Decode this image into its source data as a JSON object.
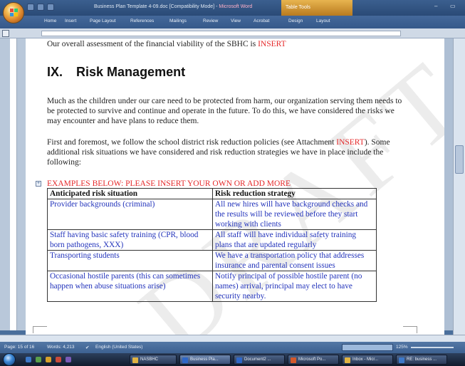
{
  "window": {
    "title_doc": "Business Plan Template 4-09.doc [Compatibility Mode] - ",
    "title_app": "Microsoft Word",
    "table_tools": "Table Tools",
    "min": "–",
    "max": "▭"
  },
  "ribbon": {
    "tabs": [
      "Home",
      "Insert",
      "Page Layout",
      "References",
      "Mailings",
      "Review",
      "View",
      "Acrobat",
      "Design",
      "Layout"
    ]
  },
  "document": {
    "top_line_text": "Our overall assessment of the financial viability of the SBHC is ",
    "top_line_insert": "INSERT",
    "heading_number": "IX.",
    "heading_text": "Risk Management",
    "para1": "Much as the children under our care need to be protected from harm, our organization serving them needs to be protected to survive and continue and operate in the future. To do this, we have considered the risks we may encounter and have plans to reduce them.",
    "para2_a": "First and foremost, we follow the school district risk reduction policies (see Attachment ",
    "para2_insert": "INSERT",
    "para2_b": ").  Some additional risk situations we have considered and risk reduction strategies we have in place include the following:",
    "examples_label": "EXAMPLES BELOW: PLEASE INSERT YOUR OWN OR ADD MORE",
    "watermark": "DRAFT",
    "table": {
      "headers": [
        "Anticipated risk situation",
        "Risk reduction strategy"
      ],
      "rows": [
        [
          "Provider backgrounds (criminal)",
          "All new hires will have background checks and the results will be reviewed before they start working with clients"
        ],
        [
          "Staff having basic safety training (CPR, blood born pathogens, XXX)",
          "All staff will have individual safety training plans that are updated regularly"
        ],
        [
          "Transporting students",
          "We have a transportation policy that addresses insurance and parental consent issues"
        ],
        [
          "Occasional hostile parents (this can sometimes happen when abuse situations arise)",
          "Notify principal of possible hostile parent (no names) arrival, principal may elect to have security nearby."
        ]
      ]
    }
  },
  "status": {
    "page": "Page: 15 of 16",
    "words": "Words: 4,213",
    "language": "English (United States)",
    "zoom": "125%"
  },
  "taskbar": {
    "items": [
      "NASBHC",
      "Business Pla...",
      "Document2 ...",
      "Microsoft Po...",
      "Inbox - Micr...",
      "RE: business ..."
    ]
  },
  "colors": {
    "placeholder_red": "#e5292a",
    "table_text_blue": "#2233bb",
    "table_tools_orange": "#d99a35"
  }
}
